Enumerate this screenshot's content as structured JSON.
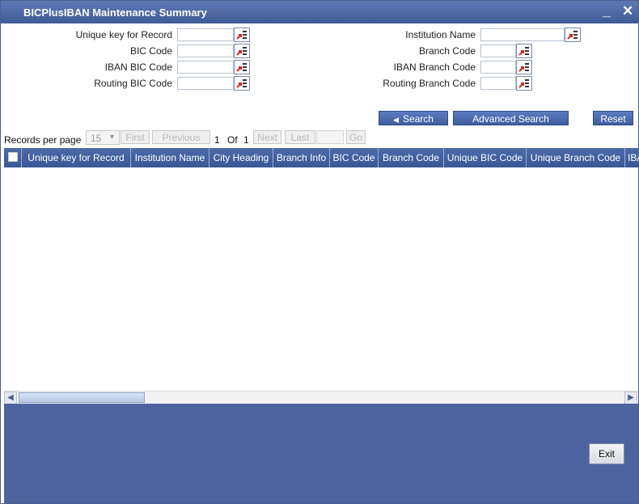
{
  "window": {
    "title": "BICPlusIBAN Maintenance Summary",
    "minimize_glyph": "_",
    "close_glyph": "✕"
  },
  "search_fields": {
    "unique_key": {
      "label": "Unique key for Record",
      "value": ""
    },
    "institution_name": {
      "label": "Institution Name",
      "value": ""
    },
    "bic_code": {
      "label": "BIC Code",
      "value": ""
    },
    "branch_code": {
      "label": "Branch Code",
      "value": ""
    },
    "iban_bic_code": {
      "label": "IBAN BIC Code",
      "value": ""
    },
    "iban_branch_code": {
      "label": "IBAN Branch Code",
      "value": ""
    },
    "routing_bic_code": {
      "label": "Routing BIC Code",
      "value": ""
    },
    "routing_branch_code": {
      "label": "Routing Branch Code",
      "value": ""
    }
  },
  "actions": {
    "search": "Search",
    "advanced_search": "Advanced Search",
    "reset": "Reset"
  },
  "pagination": {
    "records_label": "Records per page",
    "records_per_page": "15",
    "first": "First",
    "previous": "Previous",
    "current_page": "1",
    "of_label": "Of",
    "total_pages": "1",
    "next": "Next",
    "last": "Last",
    "goto_value": "",
    "go": "Go"
  },
  "grid": {
    "columns": [
      "Unique key for Record",
      "Institution Name",
      "City Heading",
      "Branch Info",
      "BIC Code",
      "Branch Code",
      "Unique BIC Code",
      "Unique Branch Code",
      "IBA"
    ],
    "rows": []
  },
  "footer": {
    "exit": "Exit"
  },
  "colors": {
    "title_bar": "#4a66a4",
    "footer": "#4d64a0",
    "grid_header": "#4465a3",
    "button": "#4e6db0"
  },
  "icons": {
    "lov": "list-of-values-icon",
    "search_arrow": "arrow-left-icon"
  }
}
